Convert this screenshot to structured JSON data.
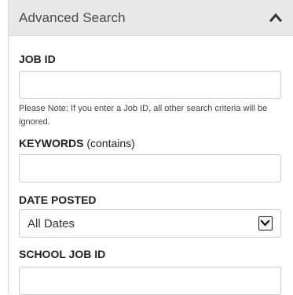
{
  "panel": {
    "title": "Advanced Search"
  },
  "fields": {
    "job_id": {
      "label": "JOB ID",
      "value": "",
      "placeholder": ""
    },
    "note": "Please Note: If you enter a Job ID, all other search criteria will be ignored.",
    "keywords": {
      "label": "KEYWORDS",
      "label_suffix": "(contains)",
      "value": "",
      "placeholder": ""
    },
    "date_posted": {
      "label": "DATE POSTED",
      "selected": "All Dates"
    },
    "school_job_id": {
      "label": "SCHOOL JOB ID",
      "value": "",
      "placeholder": ""
    }
  },
  "icons": {
    "collapse": "chevron-up-icon",
    "dropdown": "chevron-down-icon"
  },
  "colors": {
    "header_bg": "#e8e8e8",
    "input_border": "#cccccc"
  }
}
